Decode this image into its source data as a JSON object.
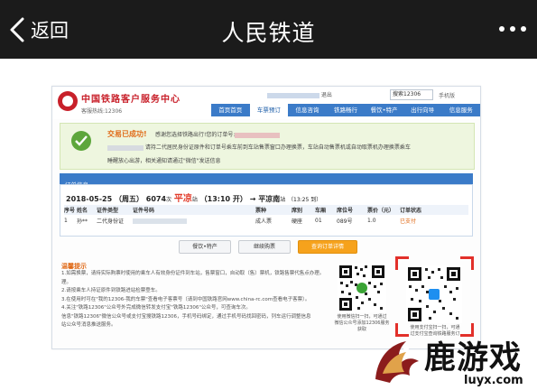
{
  "app_bar": {
    "back_label": "返回",
    "title": "人民铁道"
  },
  "site": {
    "name": "中国铁路客户服务中心",
    "hotline": "客服热线:12306",
    "user_email_suffix": "12306yii@qq.com.cn",
    "logout": "退出",
    "search_placeholder": "搜索12306",
    "phone_label": "手机版",
    "nav": [
      "首页首页",
      "车票预订",
      "信息咨询",
      "铁路畅行",
      "餐饮•特产",
      "出行向导",
      "信息服务"
    ],
    "active_nav_index": 1
  },
  "success": {
    "title": "交易已成功!",
    "subtitle": "感谢您选择铁路出行!您的订单号:",
    "detail": "请持二代居民身份证原件和订单号乘车前到车站售票窗口办理换票，车站自动售票机或自动取票机办理换票乘车",
    "note": "睡醒放心出游，相关通知请通过\"微信\"发送信息"
  },
  "order": {
    "section_title": "订单信息",
    "date": "2018-05-25",
    "weekday": "（周五）",
    "train": "6074",
    "train_suffix": "次",
    "from": "平凉",
    "from_suffix": "站",
    "depart": "（13:10 开）",
    "arrow": "→",
    "to": "平凉南",
    "to_suffix": "站",
    "arrive": "（13:25 到）",
    "headers": [
      "序号",
      "姓名",
      "证件类型",
      "证件号码",
      "",
      "票种",
      "席别",
      "车厢",
      "席位号",
      "票价（元）",
      "订单状态"
    ],
    "rows": [
      [
        "1",
        "孙**",
        "二代身份证",
        "",
        "",
        "成人票",
        "硬座",
        "01",
        "089号",
        "1.0",
        "已支付"
      ]
    ]
  },
  "buttons": {
    "food": "餐饮•特产",
    "hotel": "继续购票",
    "query": "查询订单详情"
  },
  "tips": {
    "title": "温馨提示",
    "lines": [
      "1.如需换票，请持实际购票时使用的乘车人有效身份证件到车站，售票窗口，自动取（售）票机，铁路售票代售点办理。",
      "  理。",
      "2.请按乘车人持证原件到铁路进站检票登车。",
      "3.在使用时可在\"我的12306-我的车票\"查看电子客票号（请到中国铁路官网www.china-rc.com查看电子客票）。",
      "4.关注\"铁路12306\"公众号外完成微信转发支付宝\"铁路12306\"公众号，可查询车次。",
      "  信息\"铁路12306\"微信公众号或支付宝搜铁路12306，手机号码绑定，通过手机号码找回密码，列车运行调整信息",
      "  站公众号消息推送服务。"
    ]
  },
  "qr": {
    "left_caption_1": "使用微信扫一扫，可通过",
    "left_caption_2": "微信公众号添加12306服务",
    "left_caption_3": "获取",
    "right_caption_1": "使用支付宝扫一扫，可通",
    "right_caption_2": "过支付宝查询铁路服务订"
  },
  "watermark": {
    "text": "鹿游戏",
    "url": "luyx.com"
  }
}
